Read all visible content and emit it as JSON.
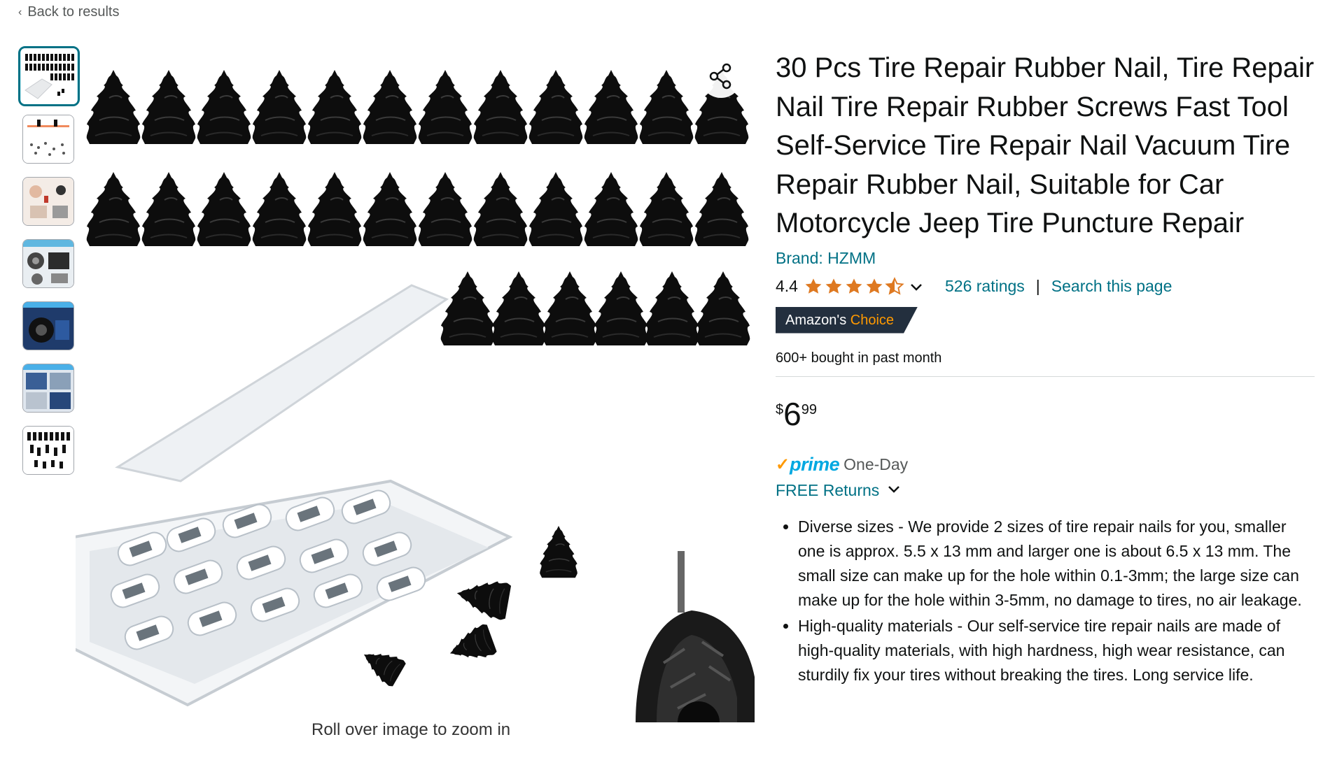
{
  "nav": {
    "back_label": "Back to results"
  },
  "gallery": {
    "thumbnails": [
      {
        "name": "thumbnail-1",
        "selected": true
      },
      {
        "name": "thumbnail-2",
        "selected": false
      },
      {
        "name": "thumbnail-3",
        "selected": false
      },
      {
        "name": "thumbnail-4",
        "selected": false
      },
      {
        "name": "thumbnail-5",
        "selected": false
      },
      {
        "name": "thumbnail-6",
        "selected": false
      },
      {
        "name": "thumbnail-7",
        "selected": false
      }
    ],
    "zoom_hint": "Roll over image to zoom in",
    "share_icon": "share-icon"
  },
  "product": {
    "title": "30 Pcs Tire Repair Rubber Nail, Tire Repair Nail Tire Repair Rubber Screws Fast Tool Self-Service Tire Repair Nail Vacuum Tire Repair Rubber Nail, Suitable for Car Motorcycle Jeep Tire Puncture Repair",
    "brand": "Brand: HZMM",
    "rating_value": "4.4",
    "rating_stars": 4.4,
    "ratings_count": "526 ratings",
    "separator": "|",
    "search_link": "Search this page",
    "badge_prefix": "Amazon's",
    "badge_highlight": "Choice",
    "bought": "600+ bought in past month",
    "price_symbol": "$",
    "price_whole": "6",
    "price_fraction": "99",
    "prime_check": "✓",
    "prime_word": "prime",
    "prime_delivery": "One-Day",
    "returns": "FREE Returns",
    "bullets": [
      "Diverse sizes - We provide 2 sizes of tire repair nails for you, smaller one is approx. 5.5 x 13 mm and larger one is about 6.5 x 13 mm. The small size can make up for the hole within 0.1-3mm; the large size can make up for the hole within 3-5mm, no damage to tires, no air leakage.",
      "High-quality materials - Our self-service tire repair nails are made of high-quality materials, with high hardness, high wear resistance, can sturdily fix your tires without breaking the tires. Long service life."
    ]
  },
  "colors": {
    "link": "#007185",
    "star": "#de7921",
    "badge_bg": "#232f3e",
    "badge_accent": "#ff9900",
    "prime_blue": "#00a8e1",
    "selected_border": "#007185"
  }
}
